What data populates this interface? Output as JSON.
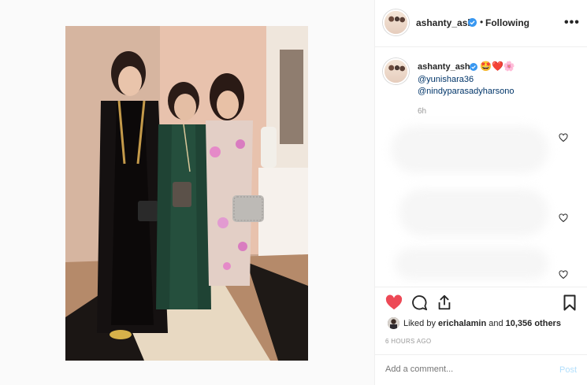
{
  "post": {
    "username": "ashanty_ash",
    "separator": "•",
    "follow_status": "Following",
    "more_icon": "•••"
  },
  "caption": {
    "username": "ashanty_ash",
    "emojis": "🤩❤️🌸",
    "mentions": [
      "@yunishara36",
      "@nindyparasadyharsono"
    ],
    "time": "6h"
  },
  "engagement": {
    "liked_by_prefix": "Liked by ",
    "liked_by_user": "erichalamin",
    "liked_by_middle": " and ",
    "others": "10,356 others",
    "age": "6 HOURS AGO"
  },
  "comment_form": {
    "placeholder": "Add a comment...",
    "post_label": "Post"
  },
  "colors": {
    "like_red": "#ed4956",
    "verified_blue": "#3897f0",
    "link_blue": "#003569",
    "post_disabled": "#b2dffc"
  }
}
